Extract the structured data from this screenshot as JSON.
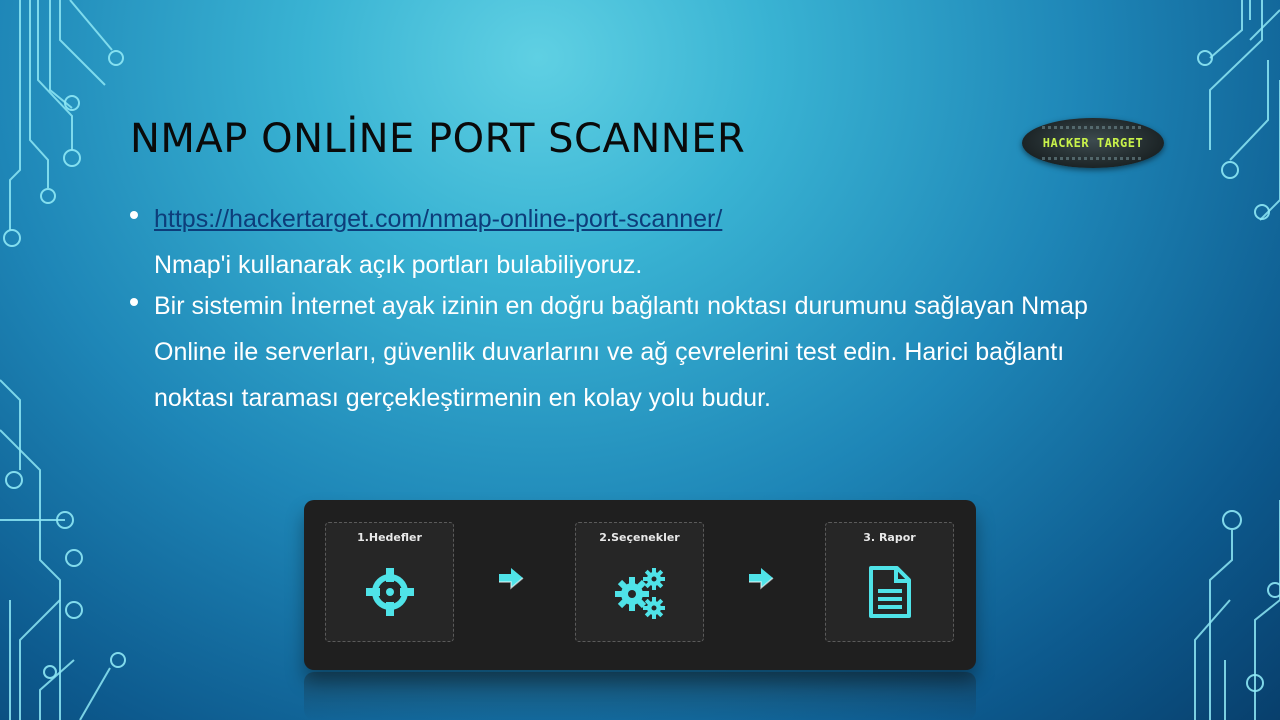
{
  "slide": {
    "title": "NMAP ONLİNE PORT SCANNER",
    "logo_text": "HACKER TARGET"
  },
  "bullets": [
    {
      "link": "https://hackertarget.com/nmap-online-port-scanner/",
      "text": "Nmap'i kullanarak açık portları bulabiliyoruz."
    },
    {
      "text": "Bir sistemin İnternet ayak izinin en doğru bağlantı noktası durumunu sağlayan Nmap Online ile serverları, güvenlik duvarlarını ve ağ çevrelerini test edin. Harici bağlantı noktası taraması gerçekleştirmenin en kolay yolu budur."
    }
  ],
  "workflow": {
    "steps": [
      {
        "label": "1.Hedefler",
        "icon": "crosshair-icon"
      },
      {
        "label": "2.Seçenekler",
        "icon": "gears-icon"
      },
      {
        "label": "3. Rapor",
        "icon": "document-icon"
      }
    ],
    "arrow_icon": "arrow-right-icon"
  },
  "colors": {
    "accent": "#4fe3e8",
    "link": "#0d3d7a",
    "title": "#0a0a0a",
    "panel": "#1f1f1f"
  }
}
